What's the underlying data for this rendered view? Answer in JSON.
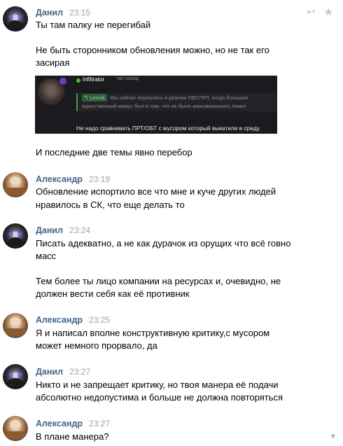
{
  "header_actions": {
    "reply_icon": "↩",
    "star_icon": "★"
  },
  "messages": [
    {
      "author": "Данил",
      "time": "23:15",
      "lines": [
        "Ты там палку не перегибай",
        "Не быть сторонником обновления можно, но не так его",
        "засирая"
      ],
      "screenshot": {
        "user": "Infiltrator",
        "when": "час назад",
        "quote_tag": "Lesnik",
        "quote_text": "Мы сейчас вернулись в реалии ОБТ,ПРТ, когда большая",
        "quote_text2": "единственный минус был в том, что не было максимального лимит",
        "reply": "Не надо сравнивать ПРТ/ОБТ с мусором который выкатили в среду."
      },
      "after_lines": [
        "И последние две темы явно перебор"
      ]
    },
    {
      "author": "Александр",
      "time": "23:19",
      "lines": [
        "Обновление испортило все что мне и куче других людей",
        "нравилось в СК, что еще делать то"
      ]
    },
    {
      "author": "Данил",
      "time": "23:24",
      "lines": [
        "Писать адекватно, а не как дурачок из орущих что всё говно",
        "масс",
        "Тем более ты лицо компании на ресурсах и, очевидно, не",
        "должен вести себя как её противник"
      ]
    },
    {
      "author": "Александр",
      "time": "23:25",
      "lines": [
        "Я и написал вполне конструктивную критику,с мусором",
        "может немного прорвало, да"
      ]
    },
    {
      "author": "Данил",
      "time": "23:27",
      "lines": [
        "Никто и не запрещает критику, но твоя манера её подачи",
        "абсолютно недопустима и больше не должна повторяться"
      ]
    },
    {
      "author": "Александр",
      "time": "23:27",
      "lines": [
        "В плане манера?"
      ]
    }
  ]
}
